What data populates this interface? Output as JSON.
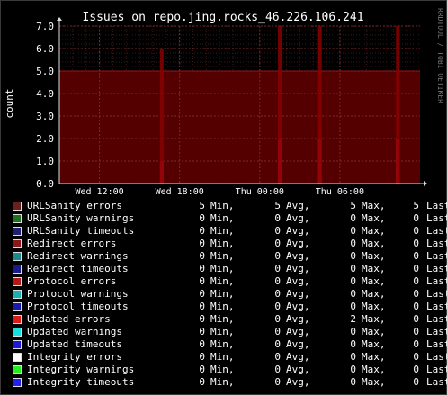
{
  "chart_data": {
    "type": "area",
    "title": "Issues on repo.jing.rocks_46.226.106.241",
    "ylabel": "count",
    "watermark": "RRDTOOL / TOBI OETIKER",
    "ylim": [
      0,
      7
    ],
    "yticks": [
      "0.0",
      "1.0",
      "2.0",
      "3.0",
      "4.0",
      "5.0",
      "6.0",
      "7.0"
    ],
    "xticks": [
      "Wed 12:00",
      "Wed 18:00",
      "Thu 00:00",
      "Thu 06:00"
    ],
    "grid": true,
    "background_fill": {
      "series": "URLSanity errors",
      "value": 5,
      "color": "#5a0000"
    },
    "spikes": [
      {
        "series": "Updated errors",
        "x": "Wed 16:40",
        "value": 1,
        "color": "#dd1a3a"
      },
      {
        "series": "Updated errors",
        "x": "Thu 01:30",
        "value": 2,
        "color": "#dd1a3a"
      },
      {
        "series": "Updated errors",
        "x": "Thu 04:30",
        "value": 2,
        "color": "#dd1a3a"
      },
      {
        "series": "Updated errors",
        "x": "Thu 10:20",
        "value": 2,
        "color": "#dd1a3a"
      },
      {
        "series": "URLSanity errors",
        "x": "Wed 16:40",
        "value": 6,
        "color": "#8a0000"
      },
      {
        "series": "URLSanity errors",
        "x": "Thu 01:30",
        "value": 7,
        "color": "#8a0000"
      },
      {
        "series": "URLSanity errors",
        "x": "Thu 04:30",
        "value": 7,
        "color": "#8a0000"
      },
      {
        "series": "URLSanity errors",
        "x": "Thu 10:20",
        "value": 7,
        "color": "#8a0000"
      }
    ],
    "series": [
      {
        "name": "URLSanity errors",
        "color": "#6b2020",
        "min": "5",
        "avg": "5",
        "max": "5",
        "last": "5"
      },
      {
        "name": "URLSanity warnings",
        "color": "#207020",
        "min": "0",
        "avg": "0",
        "max": "0",
        "last": "0"
      },
      {
        "name": "URLSanity timeouts",
        "color": "#202070",
        "min": "0",
        "avg": "0",
        "max": "0",
        "last": "0"
      },
      {
        "name": "Redirect errors",
        "color": "#8a1a1a",
        "min": "0",
        "avg": "0",
        "max": "0",
        "last": "0"
      },
      {
        "name": "Redirect warnings",
        "color": "#1a8a8a",
        "min": "0",
        "avg": "0",
        "max": "0",
        "last": "0"
      },
      {
        "name": "Redirect timeouts",
        "color": "#1a1a8a",
        "min": "0",
        "avg": "0",
        "max": "0",
        "last": "0"
      },
      {
        "name": "Protocol errors",
        "color": "#b01a1a",
        "min": "0",
        "avg": "0",
        "max": "0",
        "last": "0"
      },
      {
        "name": "Protocol warnings",
        "color": "#1ab0b0",
        "min": "0",
        "avg": "0",
        "max": "0",
        "last": "0"
      },
      {
        "name": "Protocol timeouts",
        "color": "#1a1ab0",
        "min": "0",
        "avg": "0",
        "max": "0",
        "last": "0"
      },
      {
        "name": "Updated errors",
        "color": "#dd1a1a",
        "min": "0",
        "avg": "0",
        "max": "2",
        "last": "0"
      },
      {
        "name": "Updated warnings",
        "color": "#1adddd",
        "min": "0",
        "avg": "0",
        "max": "0",
        "last": "0"
      },
      {
        "name": "Updated timeouts",
        "color": "#1a1add",
        "min": "0",
        "avg": "0",
        "max": "0",
        "last": "0"
      },
      {
        "name": "Integrity errors",
        "color": "#ffffff",
        "min": "0",
        "avg": "0",
        "max": "0",
        "last": "0"
      },
      {
        "name": "Integrity warnings",
        "color": "#22ee22",
        "min": "0",
        "avg": "0",
        "max": "0",
        "last": "0"
      },
      {
        "name": "Integrity timeouts",
        "color": "#2222ee",
        "min": "0",
        "avg": "0",
        "max": "0",
        "last": "0"
      }
    ]
  },
  "legend_labels": {
    "min": "Min,",
    "avg": "Avg,",
    "max": "Max,",
    "last": "Last"
  }
}
